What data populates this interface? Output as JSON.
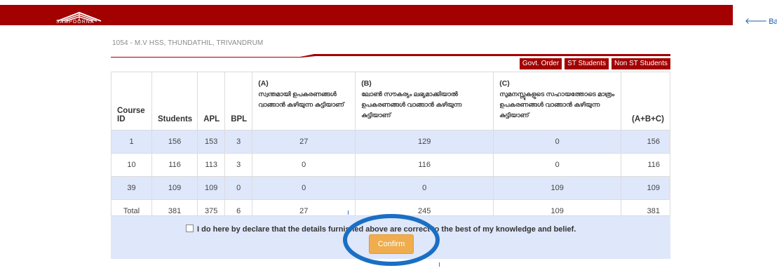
{
  "logo": {
    "text": "SAMPOORNA",
    "icon": "sampoorna-book-icon"
  },
  "back": {
    "label": "Back",
    "icon": "arrow-left-icon"
  },
  "school": {
    "name": "1054 - M.V HSS, THUNDATHIL, TRIVANDRUM"
  },
  "tabs": {
    "govt_order": "Govt. Order",
    "st_students": "ST Students",
    "non_st_students": "Non ST Students"
  },
  "table": {
    "headers": {
      "course_id": "Course ID",
      "students": "Students",
      "apl": "APL",
      "bpl": "BPL",
      "a_head": "(A)",
      "a_text": "സ്വന്തമായി ഉപകരണങ്ങൾ വാങ്ങാൻ കഴിയുന്ന കുട്ടിയാണ്",
      "b_head": "(B)",
      "b_text": "ലോൺ സൗകര്യം ലഭ്യമാക്കിയാൽ ഉപകരണങ്ങൾ വാങ്ങാൻ കഴിയുന്ന കുട്ടിയാണ്",
      "c_head": "(C)",
      "c_text": "സുമനസ്സുകളുടെ സഹായത്തോടെ മാത്രം ഉപകരണങ്ങൾ വാങ്ങാൻ കഴിയുന്ന കുട്ടിയാണ്",
      "abc": "(A+B+C)"
    },
    "rows": [
      {
        "course_id": "1",
        "students": "156",
        "apl": "153",
        "bpl": "3",
        "a": "27",
        "b": "129",
        "c": "0",
        "abc": "156"
      },
      {
        "course_id": "10",
        "students": "116",
        "apl": "113",
        "bpl": "3",
        "a": "0",
        "b": "116",
        "c": "0",
        "abc": "116"
      },
      {
        "course_id": "39",
        "students": "109",
        "apl": "109",
        "bpl": "0",
        "a": "0",
        "b": "0",
        "c": "109",
        "abc": "109"
      }
    ],
    "total": {
      "label": "Total",
      "students": "381",
      "apl": "375",
      "bpl": "6",
      "a": "27",
      "b": "245",
      "c": "109",
      "abc": "381"
    }
  },
  "declaration": {
    "text": "I do here by declare that the details furnished above are correct to the best of my knowledge and belief.",
    "checked": false
  },
  "confirm": {
    "label": "Confirm"
  },
  "colors": {
    "brand": "#a30000",
    "row_highlight": "#dfe7fb",
    "confirm": "#f0ad4e",
    "annotation": "#1a6fc4"
  }
}
